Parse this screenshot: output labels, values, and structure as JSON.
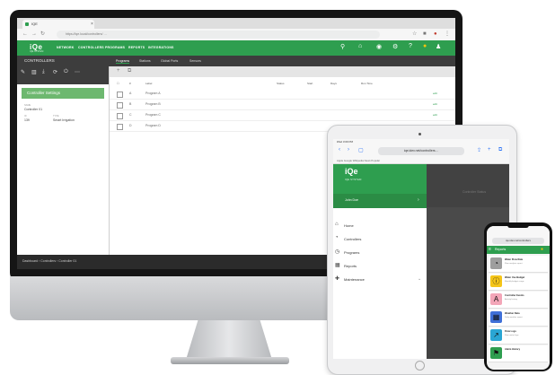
{
  "imac": {
    "browser_tab": "IQE",
    "url": "https://iqe.local/controllers/ …",
    "nav": {
      "logo": "iQe",
      "logo_sub": "IQE SYSTEM",
      "items": [
        "NETWORK",
        "CONTROLLERS",
        "PROGRAMS",
        "REPORTS",
        "INTEGRATIONS"
      ]
    },
    "section_title": "CONTROLLERS",
    "tabs": [
      "Programs",
      "Stations",
      "Global Ports",
      "Sensors"
    ],
    "card_title": "Controller Settings",
    "meta": [
      {
        "label": "NAME",
        "value": "Controller 01"
      },
      {
        "label": "ID",
        "value": "139"
      },
      {
        "label": "TYPE",
        "value": "Smart Irrigation"
      }
    ],
    "columns": [
      "#",
      "Label",
      "Status",
      "Start",
      "Days",
      "Run Time"
    ],
    "rows": [
      {
        "num": "A",
        "label": "Program A",
        "link": "edit"
      },
      {
        "num": "B",
        "label": "Program B",
        "link": "edit"
      },
      {
        "num": "C",
        "label": "Program C",
        "link": "edit"
      },
      {
        "num": "D",
        "label": "Program D",
        "link": "edit"
      }
    ],
    "breadcrumb": "Dashboard › Controllers › Controller 01"
  },
  "tablet": {
    "status": "iPad  3:09 PM",
    "url": "iqe.idev.net/controllers…",
    "bookmarks": "Apple  Google  Wikipedia  News  Popular",
    "logo": "iQe",
    "company": "IQE SYSTEM",
    "user": "John Doe",
    "menu": [
      "Home",
      "Controllers",
      "Programs",
      "Reports",
      "Maintenance"
    ],
    "bg_title": "Controller Status"
  },
  "phone": {
    "url": "iqe.idev.net/controllers",
    "bar_title": "Reports",
    "cards": [
      {
        "title": "Water Flow Rate",
        "sub": "Flow analysis report",
        "color": "#9e9e9e",
        "icon": "◔"
      },
      {
        "title": "Water Use Budget",
        "sub": "Monthly budget usage",
        "color": "#f5c518",
        "icon": "ⓘ"
      },
      {
        "title": "Controller Events",
        "sub": "Activity history",
        "color": "#f3a6b8",
        "icon": "A"
      },
      {
        "title": "Weather Data",
        "sub": "Daily weather report",
        "color": "#3f6fd8",
        "icon": "▦"
      },
      {
        "title": "Flow Logs",
        "sub": "Flow meter logs",
        "color": "#2aa6d4",
        "icon": "↗"
      },
      {
        "title": "Alarm History",
        "sub": "",
        "color": "#2e9e4f",
        "icon": "⚑"
      }
    ]
  },
  "colors": {
    "brand_green": "#2e9e4f",
    "dark_bar": "#3d3d3d"
  }
}
